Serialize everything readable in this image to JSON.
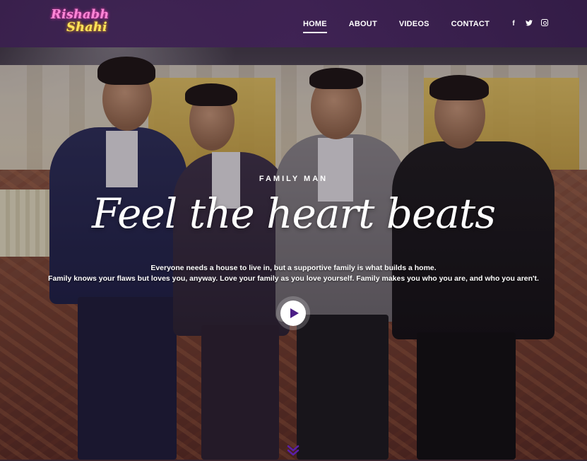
{
  "header": {
    "logo": {
      "line1": "Rishabh",
      "line2": "Shahi"
    },
    "nav": {
      "home": "HOME",
      "about": "ABOUT",
      "videos": "VIDEOS",
      "contact": "CONTACT"
    },
    "social": [
      "facebook-icon",
      "twitter-icon",
      "instagram-icon"
    ]
  },
  "hero": {
    "eyebrow": "FAMILY MAN",
    "headline": "Feel the heart beats",
    "line1": "Everyone needs a house to live in, but a supportive family is what builds a home.",
    "line2": "Family knows your flaws but loves you, anyway. Love your family as you love yourself. Family makes you who you are, and who you aren't."
  },
  "colors": {
    "header_bg": "#3f2257",
    "accent": "#4b1e86",
    "logo_pink": "#ff86d6",
    "logo_yellow": "#ffe45a"
  }
}
